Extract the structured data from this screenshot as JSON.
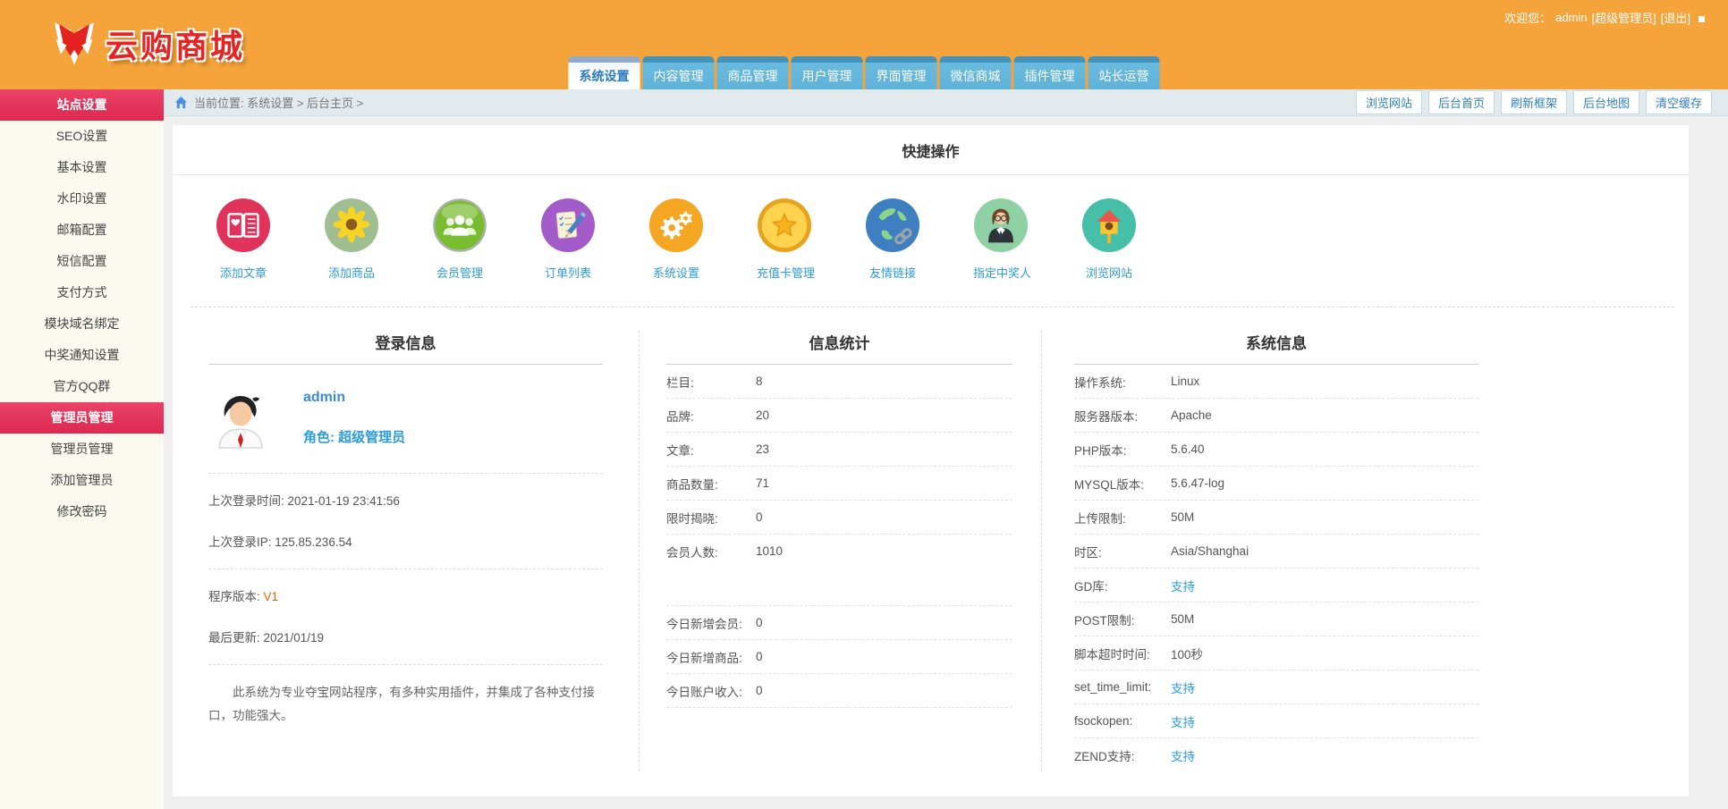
{
  "colors": {
    "header_orange": "#F4A43A",
    "sidebar_active_pink": "#E73B5F",
    "tab_blue": "#69BADF",
    "tab_active_text": "#2B7BC0",
    "link_blue": "#2D9CDB",
    "version_orange": "#FF5A00"
  },
  "header": {
    "logo_text": "云购商城",
    "welcome_prefix": "欢迎您：",
    "username": "admin",
    "role_badge": "[超级管理员]",
    "logout_label": "[退出]",
    "tabs": [
      {
        "label": "系统设置"
      },
      {
        "label": "内容管理"
      },
      {
        "label": "商品管理"
      },
      {
        "label": "用户管理"
      },
      {
        "label": "界面管理"
      },
      {
        "label": "微信商城"
      },
      {
        "label": "插件管理"
      },
      {
        "label": "站长运营"
      }
    ]
  },
  "sidebar": {
    "items": [
      {
        "label": "站点设置"
      },
      {
        "label": "SEO设置"
      },
      {
        "label": "基本设置"
      },
      {
        "label": "水印设置"
      },
      {
        "label": "邮箱配置"
      },
      {
        "label": "短信配置"
      },
      {
        "label": "支付方式"
      },
      {
        "label": "模块域名绑定"
      },
      {
        "label": "中奖通知设置"
      },
      {
        "label": "官方QQ群"
      },
      {
        "label": "管理员管理"
      },
      {
        "label": "管理员管理"
      },
      {
        "label": "添加管理员"
      },
      {
        "label": "修改密码"
      }
    ]
  },
  "breadcrumb": {
    "text": "当前位置: 系统设置 > 后台主页 >"
  },
  "toolbar": {
    "buttons": [
      "浏览网站",
      "后台首页",
      "刷新框架",
      "后台地图",
      "清空缓存"
    ]
  },
  "quick_ops": {
    "title": "快捷操作",
    "items": [
      {
        "label": "添加文章"
      },
      {
        "label": "添加商品"
      },
      {
        "label": "会员管理"
      },
      {
        "label": "订单列表"
      },
      {
        "label": "系统设置"
      },
      {
        "label": "充值卡管理"
      },
      {
        "label": "友情链接"
      },
      {
        "label": "指定中奖人"
      },
      {
        "label": "浏览网站"
      }
    ]
  },
  "panels": {
    "login": {
      "title": "登录信息",
      "username": "admin",
      "role": "角色: 超级管理员",
      "last_login_time": "上次登录时间: 2021-01-19 23:41:56",
      "last_login_ip": "上次登录IP: 125.85.236.54",
      "version_label": "程序版本: ",
      "version": "V1",
      "updated": "最后更新: 2021/01/19",
      "description": "此系统为专业夺宝网站程序，有多种实用插件，并集成了各种支付接口，功能强大。"
    },
    "stats": {
      "title": "信息统计",
      "rows": [
        {
          "label": "栏目:",
          "value": "8"
        },
        {
          "label": "品牌:",
          "value": "20"
        },
        {
          "label": "文章:",
          "value": "23"
        },
        {
          "label": "商品数量:",
          "value": "71"
        },
        {
          "label": "限时揭晓:",
          "value": "0"
        },
        {
          "label": "会员人数:",
          "value": "1010"
        }
      ],
      "today_rows": [
        {
          "label": "今日新增会员:",
          "value": "0"
        },
        {
          "label": "今日新增商品:",
          "value": "0"
        },
        {
          "label": "今日账户收入:",
          "value": "0"
        }
      ]
    },
    "system": {
      "title": "系统信息",
      "rows": [
        {
          "label": "操作系统:",
          "value": "Linux"
        },
        {
          "label": "服务器版本:",
          "value": "Apache"
        },
        {
          "label": "PHP版本:",
          "value": "5.6.40"
        },
        {
          "label": "MYSQL版本:",
          "value": "5.6.47-log"
        },
        {
          "label": "上传限制:",
          "value": "50M"
        },
        {
          "label": "时区:",
          "value": "Asia/Shanghai"
        },
        {
          "label": "GD库:",
          "value": "支持"
        },
        {
          "label": "POST限制:",
          "value": "50M"
        },
        {
          "label": "脚本超时时间:",
          "value": "100秒"
        },
        {
          "label": "set_time_limit:",
          "value": "支持"
        },
        {
          "label": "fsockopen:",
          "value": "支持"
        },
        {
          "label": "ZEND支持:",
          "value": "支持"
        }
      ]
    }
  }
}
